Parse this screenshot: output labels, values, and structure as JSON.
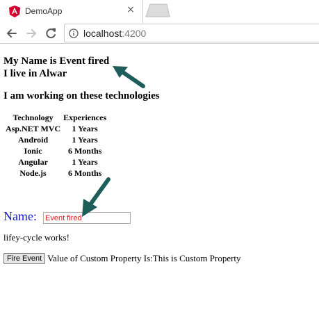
{
  "browser": {
    "tab_title": "DemoApp",
    "url_host": "localhost",
    "url_port": ":4200",
    "favicon": "angular-logo",
    "colors": {
      "favicon_red": "#dd0031",
      "annotation_arrow": "#1d5e5a"
    }
  },
  "page": {
    "name_heading": "My Name is Event fired",
    "city_heading": "I live in Alwar",
    "tech_heading": "I am working on these technologies",
    "table": {
      "headers": [
        "Technology",
        "Experiences"
      ],
      "rows": [
        [
          "Asp.NET MVC",
          "1 Years"
        ],
        [
          "Android",
          "1 Years"
        ],
        [
          "Ionic",
          "6 Months"
        ],
        [
          "Angular",
          "1 Years"
        ],
        [
          "Node.js",
          "6 Months"
        ]
      ]
    },
    "name_label": "Name:",
    "name_input_value": "Event fired",
    "lifecycle_text": "lifey-cycle works!",
    "fire_button_label": "Fire Event",
    "custom_property_text": "Value of Custom Property Is:This is Custom Property",
    "colors": {
      "name_label": "#1a1ad6",
      "input_text": "#d42020"
    }
  }
}
